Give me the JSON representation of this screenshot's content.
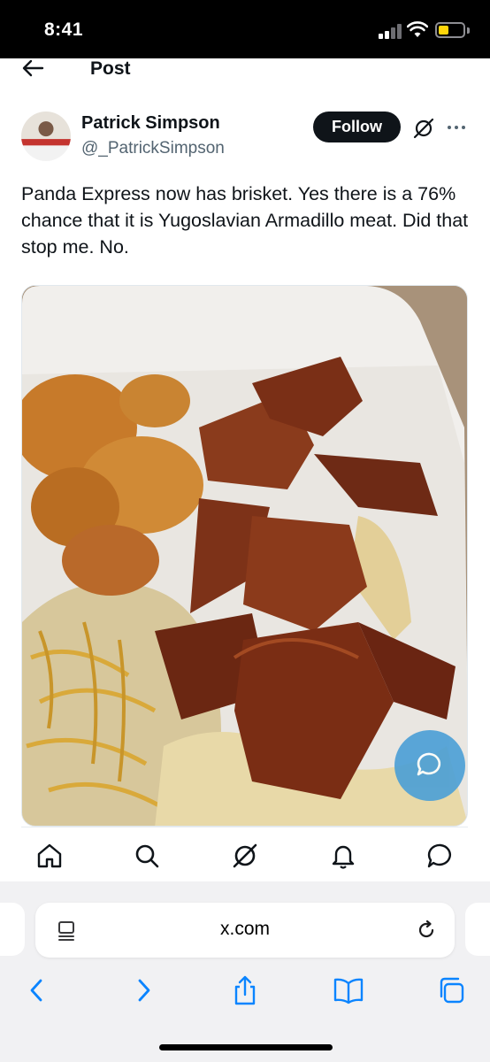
{
  "status_bar": {
    "time": "8:41"
  },
  "header": {
    "title": "Post"
  },
  "author": {
    "name": "Patrick Simpson",
    "handle": "@_PatrickSimpson",
    "follow_label": "Follow"
  },
  "tweet": {
    "text": "Panda Express now has brisket. Yes there is a 76% chance that it is Yugoslavian Armadillo meat. Did that stop me. No."
  },
  "bottom_nav": {
    "items": [
      "home-icon",
      "search-icon",
      "grok-icon",
      "notifications-icon",
      "messages-icon"
    ]
  },
  "browser": {
    "url": "x.com"
  },
  "colors": {
    "follow_bg": "#0f1419",
    "accent_blue": "#4a9fd6",
    "safari_blue": "#0a84ff",
    "battery": "#ffd60a"
  }
}
